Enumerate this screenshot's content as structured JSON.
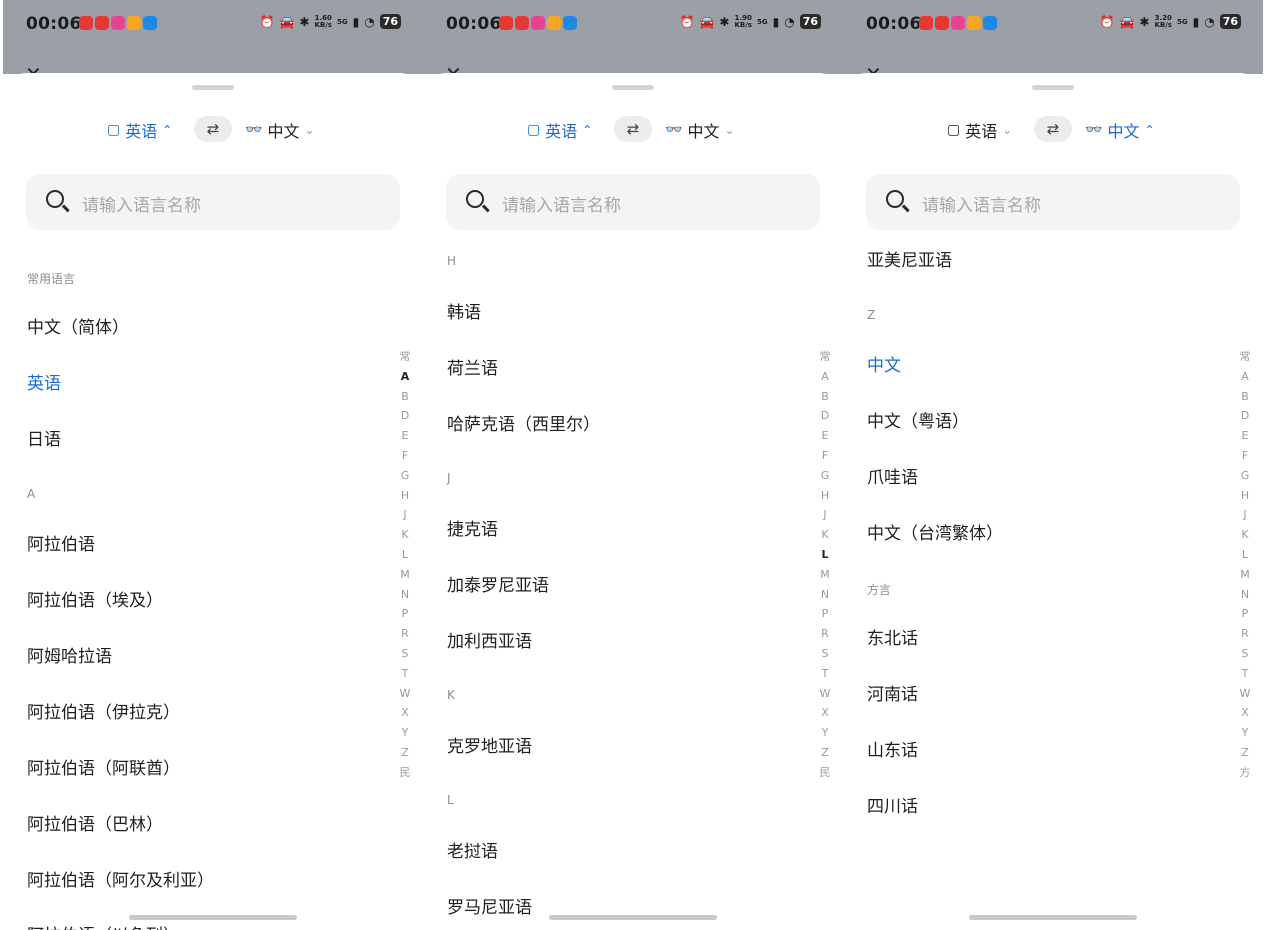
{
  "status": {
    "time": "00:06",
    "battery": "76",
    "net": "5G"
  },
  "panels": [
    {
      "speed": "1.60\nKB/s",
      "source_label": "英语",
      "target_label": "中文",
      "search_placeholder": "请输入语言名称",
      "section_common": "常用语言",
      "common": [
        "中文（简体）",
        "英语",
        "日语"
      ],
      "section_a": "A",
      "a_list": [
        "阿拉伯语",
        "阿拉伯语（埃及）",
        "阿姆哈拉语",
        "阿拉伯语（伊拉克）",
        "阿拉伯语（阿联酋）",
        "阿拉伯语（巴林）",
        "阿拉伯语（阿尔及利亚）",
        "阿拉伯语（以色列）"
      ],
      "index": [
        "常",
        "A",
        "B",
        "D",
        "E",
        "F",
        "G",
        "H",
        "J",
        "K",
        "L",
        "M",
        "N",
        "P",
        "R",
        "S",
        "T",
        "W",
        "X",
        "Y",
        "Z",
        "民"
      ]
    },
    {
      "speed": "1.90\nKB/s",
      "source_label": "英语",
      "target_label": "中文",
      "search_placeholder": "请输入语言名称",
      "sec_h": "H",
      "h_list": [
        "韩语",
        "荷兰语",
        "哈萨克语（西里尔）"
      ],
      "sec_j": "J",
      "j_list": [
        "捷克语",
        "加泰罗尼亚语",
        "加利西亚语"
      ],
      "sec_k": "K",
      "k_list": [
        "克罗地亚语"
      ],
      "sec_l": "L",
      "l_list": [
        "老挝语",
        "罗马尼亚语"
      ],
      "index": [
        "常",
        "A",
        "B",
        "D",
        "E",
        "F",
        "G",
        "H",
        "J",
        "K",
        "L",
        "M",
        "N",
        "P",
        "R",
        "S",
        "T",
        "W",
        "X",
        "Y",
        "Z",
        "民"
      ]
    },
    {
      "speed": "3.20\nKB/s",
      "source_label": "英语",
      "target_label": "中文",
      "search_placeholder": "请输入语言名称",
      "top_item": "亚美尼亚语",
      "sec_z": "Z",
      "z_list": [
        "中文",
        "中文（粤语）",
        "爪哇语",
        "中文（台湾繁体）"
      ],
      "sec_dialect": "方言",
      "dialects": [
        "东北话",
        "河南话",
        "山东话",
        "四川话"
      ],
      "index": [
        "常",
        "A",
        "B",
        "D",
        "E",
        "F",
        "G",
        "H",
        "J",
        "K",
        "L",
        "M",
        "N",
        "P",
        "R",
        "S",
        "T",
        "W",
        "X",
        "Y",
        "Z",
        "方"
      ]
    }
  ]
}
